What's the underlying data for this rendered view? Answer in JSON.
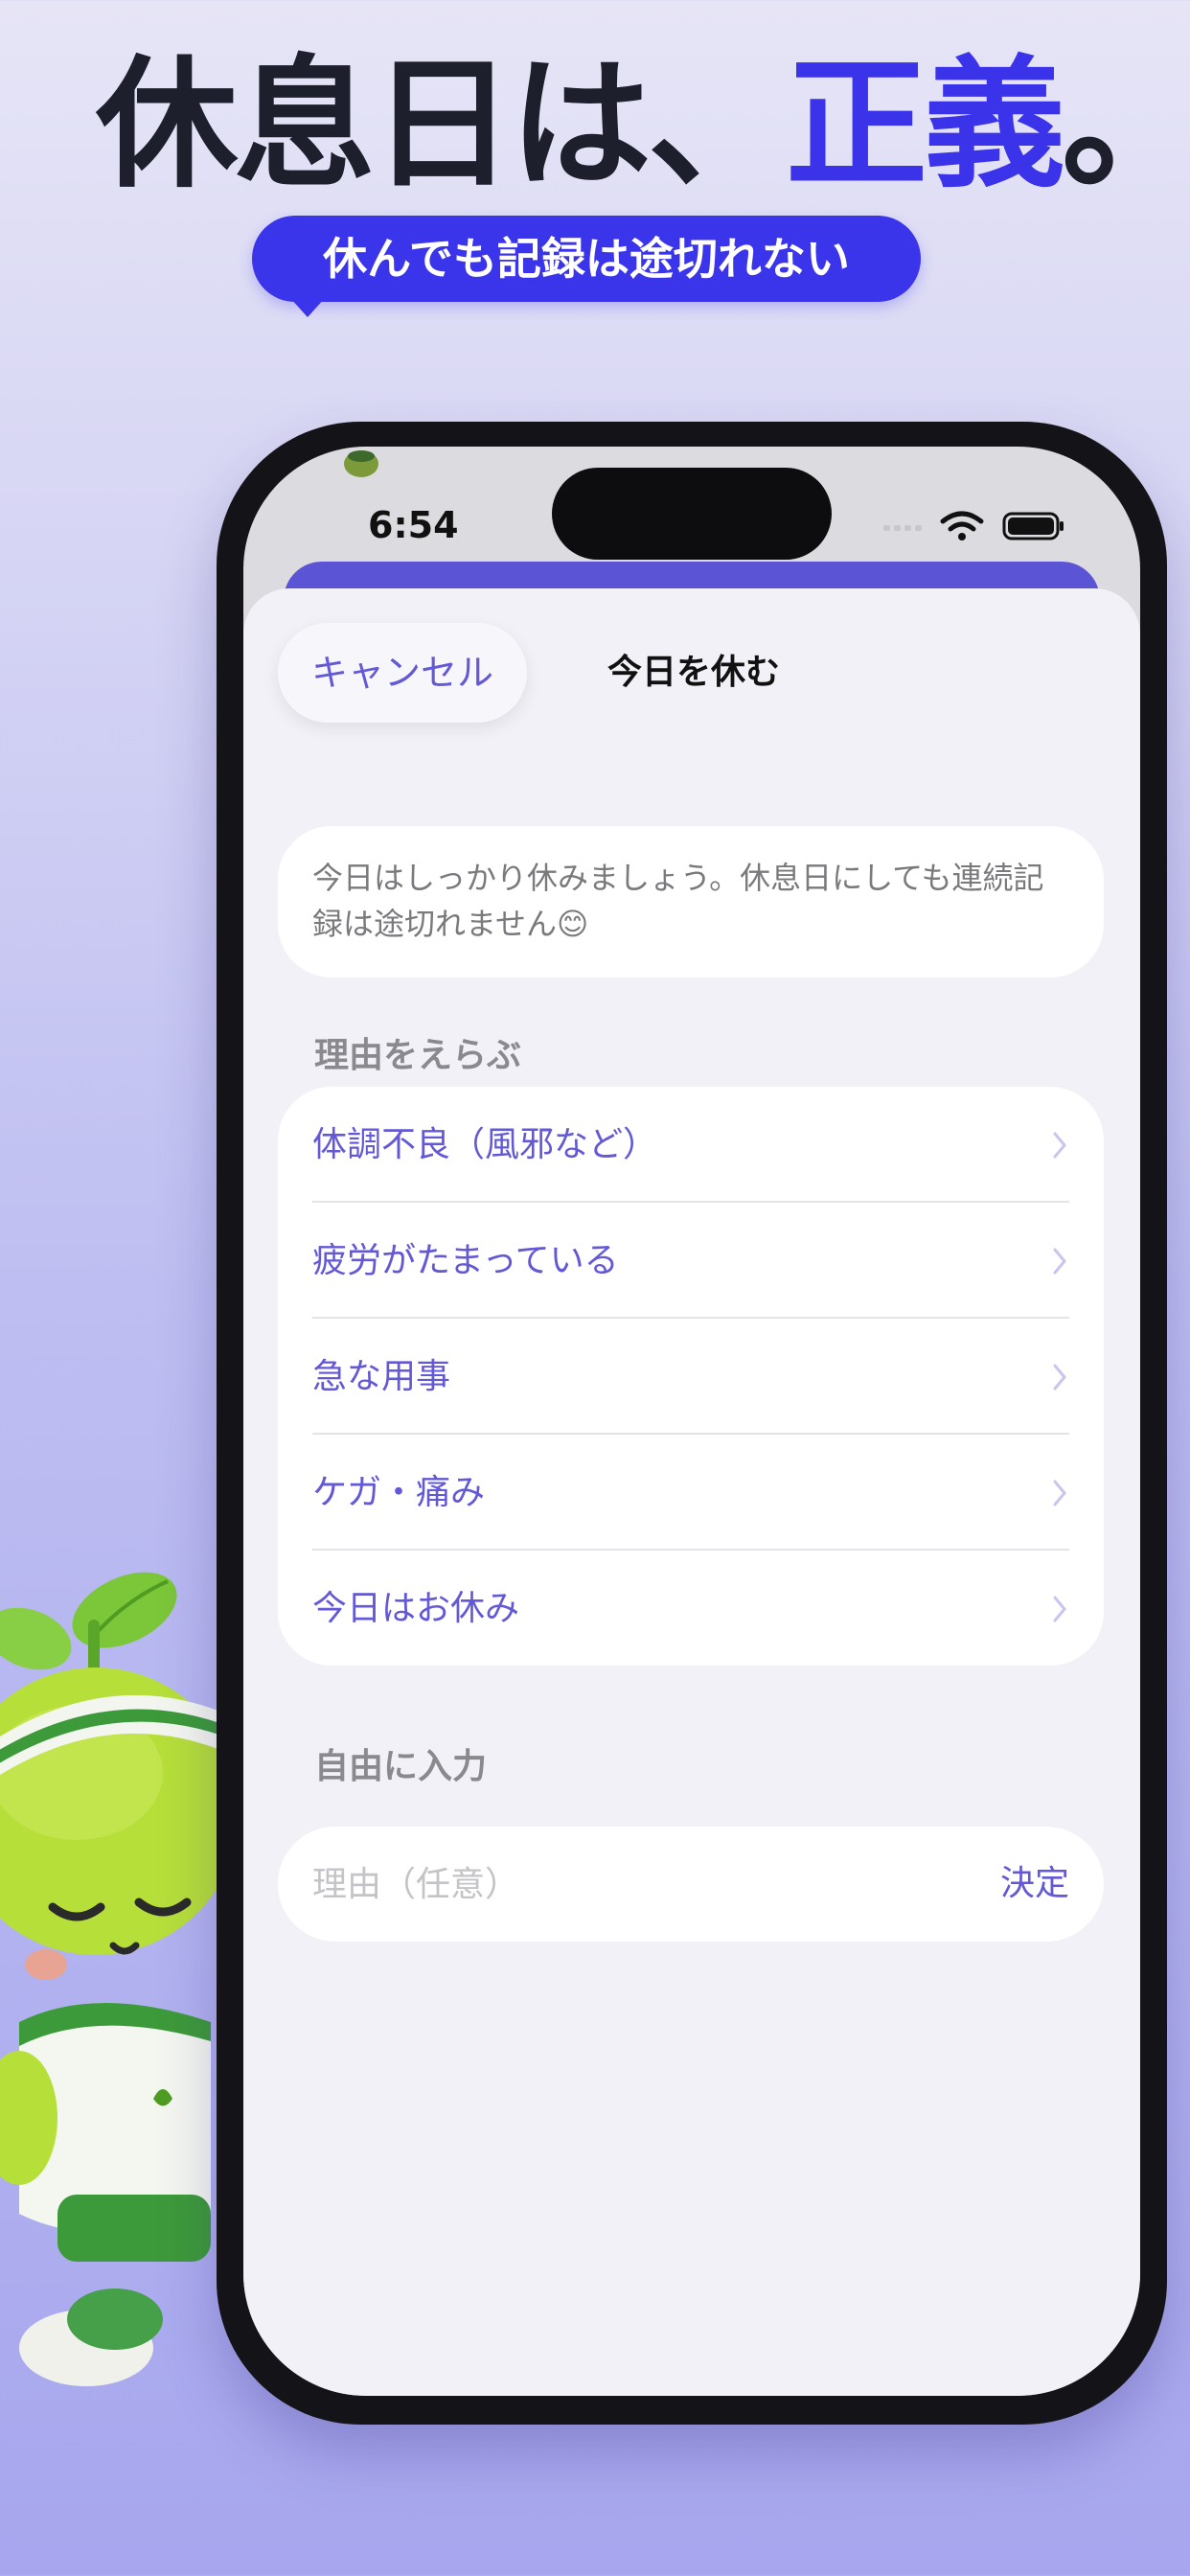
{
  "headline": {
    "part1": "休息日は、",
    "accent": "正義",
    "part2": "。",
    "accent_color": "#3b33ea"
  },
  "subhead": "休んでも記録は途切れない",
  "status_bar": {
    "time": "6:54",
    "icons": [
      "signal-icon",
      "wifi-icon",
      "battery-icon"
    ]
  },
  "sheet": {
    "cancel_label": "キャンセル",
    "title": "今日を休む",
    "info_text": "今日はしっかり休みましょう。休息日にしても連続記録は途切れません😊",
    "reasons_header": "理由をえらぶ",
    "reasons": [
      {
        "label": "体調不良（風邪など）"
      },
      {
        "label": "疲労がたまっている"
      },
      {
        "label": "急な用事"
      },
      {
        "label": "ケガ・痛み"
      },
      {
        "label": "今日はお休み"
      }
    ],
    "free_header": "自由に入力",
    "free_placeholder": "理由（任意）",
    "free_value": "",
    "confirm_label": "決定"
  },
  "colors": {
    "accent": "#6359d6",
    "pill": "#3a34ea",
    "sheet_bg": "#f2f1f7"
  }
}
